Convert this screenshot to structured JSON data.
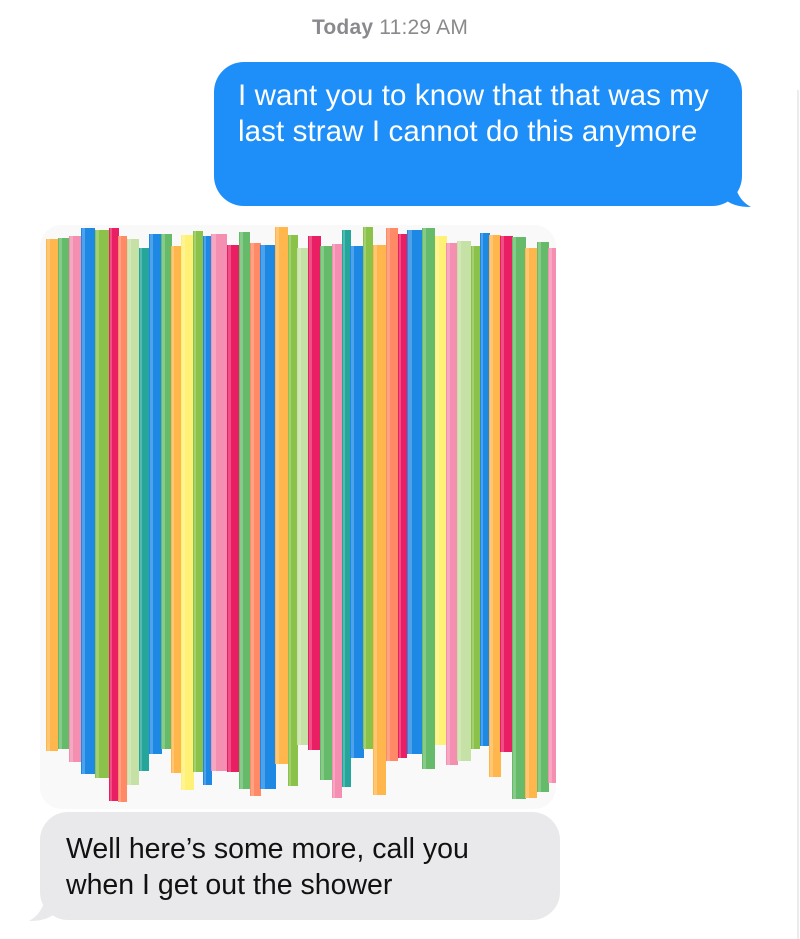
{
  "conversation": {
    "timestamp_day": "Today",
    "timestamp_time": "11:29 AM",
    "messages": [
      {
        "direction": "sent",
        "text": "I want you to know that that was my last straw I cannot do this anymore"
      },
      {
        "direction": "received",
        "type": "image",
        "image_subject": "straws-photo"
      },
      {
        "direction": "received",
        "text": "Well here’s some more, call you when I get out the shower"
      }
    ]
  },
  "colors": {
    "sent_bubble": "#1e8ff8",
    "received_bubble": "#e9e9eb",
    "timestamp_text": "#8a8a8e",
    "straw_palette": [
      "#f48fb1",
      "#ffb74d",
      "#66bb6a",
      "#8bc34a",
      "#1e88e5",
      "#e91e63",
      "#c5e1a5",
      "#ff8a65",
      "#26a69a",
      "#fff176"
    ]
  }
}
